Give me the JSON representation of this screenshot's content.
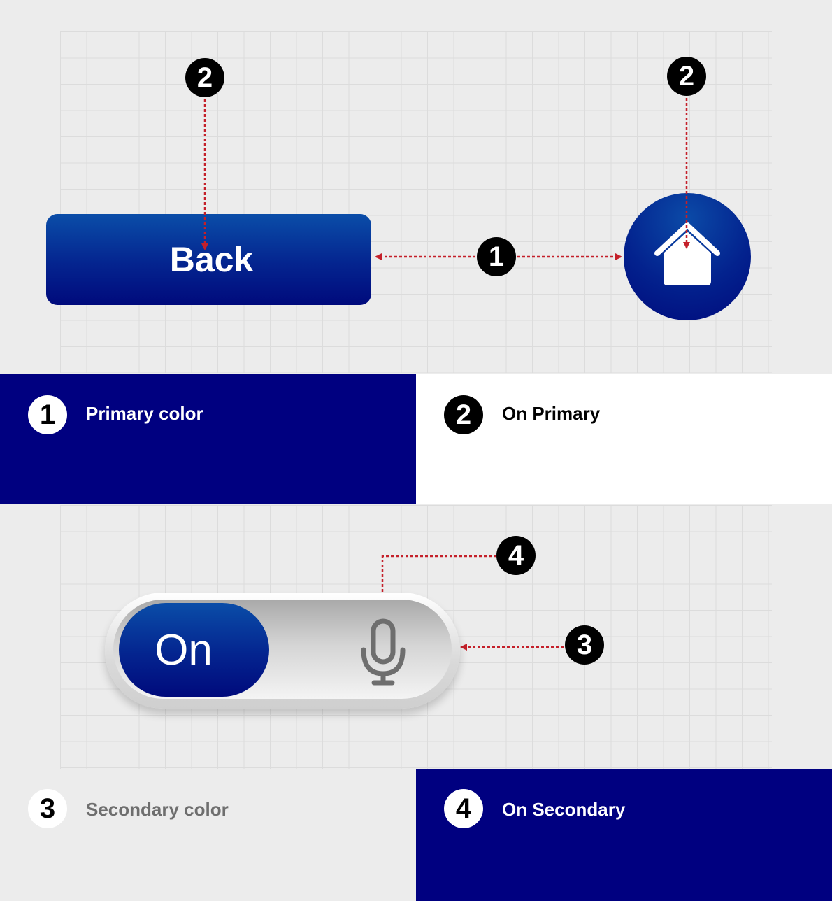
{
  "top_example": {
    "back_button_label": "Back",
    "home_icon": "home-icon"
  },
  "markers": {
    "primary_number": "1",
    "on_primary_number": "2",
    "secondary_number": "3",
    "on_secondary_number": "4"
  },
  "legend": {
    "primary": {
      "number": "1",
      "label": "Primary color"
    },
    "on_primary": {
      "number": "2",
      "label": "On Primary"
    },
    "secondary": {
      "number": "3",
      "label": "Secondary color"
    },
    "on_secondary": {
      "number": "4",
      "label": "On Secondary"
    }
  },
  "toggle": {
    "state_label": "On",
    "icon": "microphone-icon"
  },
  "colors": {
    "primary": "#000080",
    "on_primary": "#ffffff",
    "secondary": "#ececec",
    "on_secondary": "#6e6e6e",
    "annotation_arrow": "#c4202a",
    "badge": "#000000"
  }
}
